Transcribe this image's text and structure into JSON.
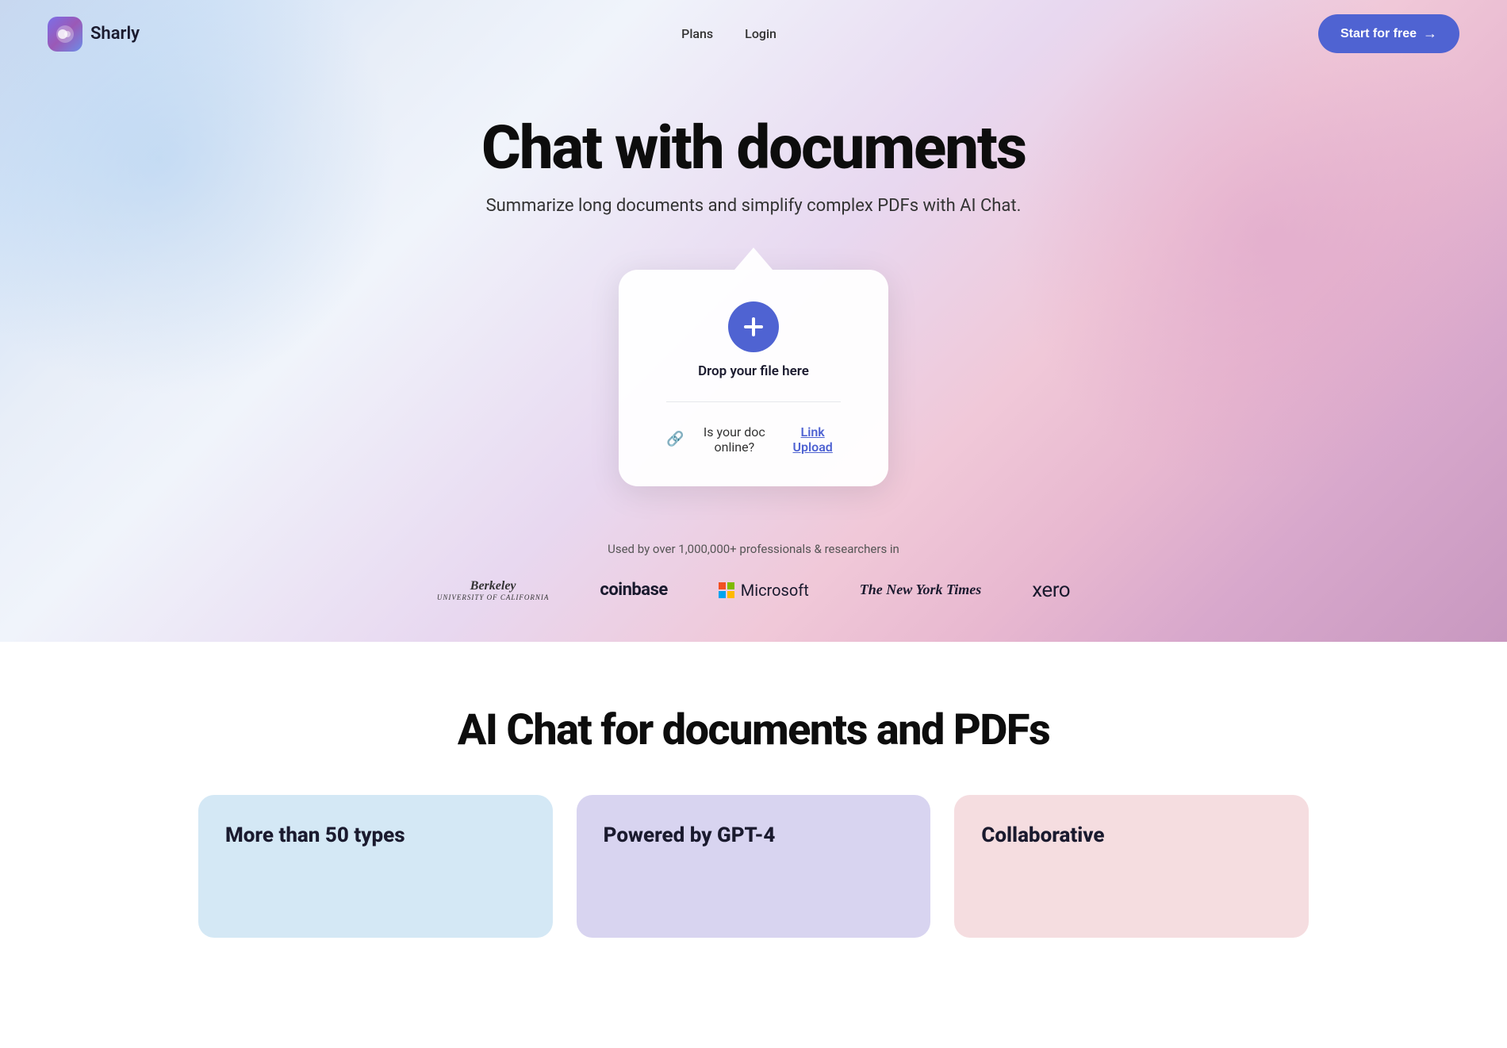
{
  "brand": {
    "name": "Sharly",
    "logo_alt": "Sharly logo"
  },
  "navbar": {
    "plans_label": "Plans",
    "login_label": "Login",
    "cta_label": "Start for free",
    "cta_arrow": "→"
  },
  "hero": {
    "title": "Chat with documents",
    "subtitle": "Summarize long documents and simplify complex PDFs with AI Chat."
  },
  "upload_card": {
    "drop_text": "Drop your file here",
    "online_doc_label": "Is your doc online?",
    "link_upload_label": "Link Upload"
  },
  "trusted": {
    "description": "Used by over 1,000,000+ professionals & researchers in",
    "logos": [
      {
        "id": "berkeley",
        "name": "Berkeley"
      },
      {
        "id": "coinbase",
        "name": "coinbase"
      },
      {
        "id": "microsoft",
        "name": "Microsoft"
      },
      {
        "id": "nyt",
        "name": "The New York Times"
      },
      {
        "id": "xero",
        "name": "xero"
      }
    ]
  },
  "ai_section": {
    "title": "AI Chat for documents and PDFs"
  },
  "features": [
    {
      "id": "types",
      "title": "More than 50 types",
      "color": "blue"
    },
    {
      "id": "gpt4",
      "title": "Powered by GPT-4",
      "color": "purple"
    },
    {
      "id": "collab",
      "title": "Collaborative",
      "color": "pink"
    }
  ]
}
